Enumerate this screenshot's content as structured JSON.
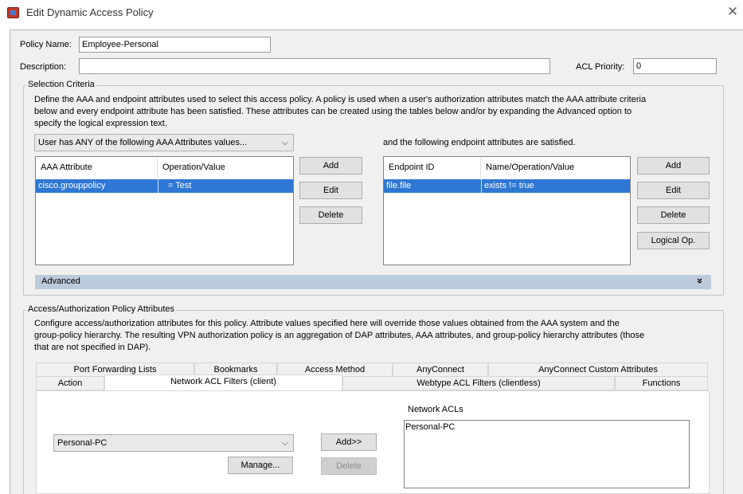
{
  "window": {
    "title": "Edit Dynamic Access Policy",
    "close_glyph": "✕"
  },
  "icons": {
    "app": "asdm-app-icon",
    "close": "close-icon",
    "dropdown": "chevron-down-icon",
    "expand": "double-chevron-down-icon"
  },
  "colors": {
    "selection": "#2f77d5",
    "advanced_bar": "#bccbdc"
  },
  "policy": {
    "name_label": "Policy Name:",
    "name_value": "Employee-Personal",
    "description_label": "Description:",
    "description_value": "",
    "acl_priority_label": "ACL Priority:",
    "acl_priority_value": "0"
  },
  "selection": {
    "group_title": "Selection Criteria",
    "desc_lines": [
      "Define the AAA and endpoint attributes used to select this access policy. A policy is used when a user's authorization attributes match the AAA attribute criteria",
      "below and every endpoint attribute has been satisfied. These attributes can be created using the tables below and/or by expanding the Advanced option to",
      "specify the logical expression text."
    ],
    "aaa_combo": "User has ANY of the following AAA Attributes values...",
    "endpoint_text": "and the following endpoint attributes are satisfied.",
    "aaa_table": {
      "headers": [
        "AAA Attribute",
        "Operation/Value"
      ],
      "rows": [
        [
          "cisco.grouppolicy",
          "=  Test"
        ]
      ]
    },
    "aaa_buttons": [
      "Add",
      "Edit",
      "Delete"
    ],
    "endpoint_table": {
      "headers": [
        "Endpoint ID",
        "Name/Operation/Value"
      ],
      "rows": [
        [
          "file.file",
          "exists  !=  true"
        ]
      ]
    },
    "endpoint_buttons": [
      "Add",
      "Edit",
      "Delete",
      "Logical Op."
    ],
    "advanced_label": "Advanced",
    "advanced_glyph": "»"
  },
  "access": {
    "group_title": "Access/Authorization Policy Attributes",
    "desc_lines": [
      "Configure access/authorization attributes for this policy. Attribute values specified here will override those values obtained from the AAA system and the",
      "group-policy hierarchy. The resulting VPN authorization policy is an aggregation of DAP attributes, AAA attributes, and group-policy hierarchy attributes (those",
      "that are not specified in DAP)."
    ],
    "tabs_row1": [
      "Port Forwarding Lists",
      "Bookmarks",
      "Access Method",
      "AnyConnect",
      "AnyConnect Custom Attributes"
    ],
    "tabs_row2": [
      "Action",
      "Network ACL Filters (client)",
      "Webtype ACL Filters (clientless)",
      "Functions"
    ],
    "active_tab": "Network ACL Filters (client)",
    "network_acls_label": "Network ACLs",
    "acl_combo_value": "Personal-PC",
    "add_button": "Add>>",
    "delete_button": "Delete",
    "manage_button": "Manage...",
    "acl_list": [
      "Personal-PC"
    ]
  }
}
